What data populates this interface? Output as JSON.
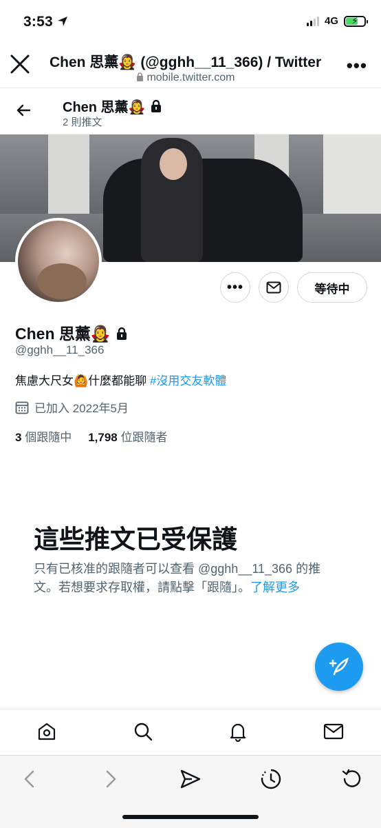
{
  "status_bar": {
    "time": "3:53",
    "network": "4G"
  },
  "browser": {
    "page_title": "Chen 思薰🧛‍♀️ (@gghh__11_366) / Twitter",
    "url": "mobile.twitter.com"
  },
  "profile_header": {
    "name": "Chen 思薰🧛‍♀️",
    "tweet_count": "2 則推文"
  },
  "actions": {
    "more": "•••",
    "pending_label": "等待中"
  },
  "profile": {
    "name": "Chen 思薰🧛‍♀️",
    "handle": "@gghh__11_366",
    "bio_text": "焦慮大尺女🙆什麼都能聊 ",
    "bio_hashtag": "#沒用交友軟體",
    "joined": "已加入 2022年5月",
    "following_count": "3",
    "following_label": "個跟隨中",
    "followers_count": "1,798",
    "followers_label": "位跟隨者"
  },
  "protected": {
    "title": "這些推文已受保護",
    "text": "只有已核准的跟隨者可以查看 @gghh__11_366 的推文。若想要求存取權，請點擊「跟隨」。",
    "link": "了解更多"
  },
  "colors": {
    "accent": "#1d9bf0",
    "text": "#0f1419",
    "muted": "#536471"
  },
  "icons": {
    "tab_bar": [
      "home-icon",
      "search-icon",
      "notifications-icon",
      "messages-icon"
    ],
    "toolbar": [
      "back-icon",
      "forward-icon",
      "send-icon",
      "history-icon",
      "reload-icon"
    ]
  }
}
